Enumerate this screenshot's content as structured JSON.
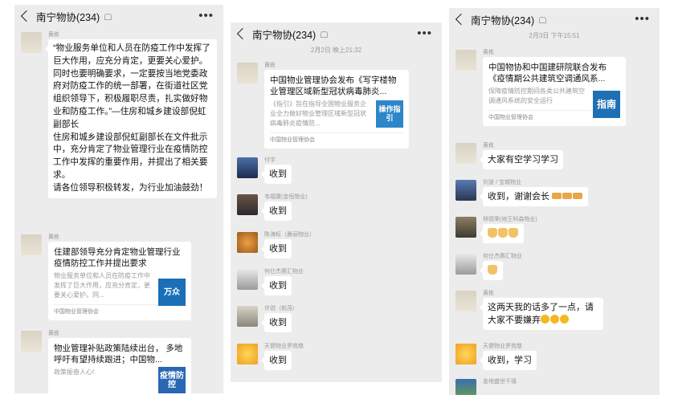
{
  "chat_title": "南宁物协(234)",
  "left": {
    "msg1": {
      "sender": "黄栋",
      "text": "“物业服务单位和人员在防疫工作中发挥了巨大作用，应充分肯定，更要关心爱护。同时也要明确要求，一定要按当地党委政府对防疫工作的统一部署，在街道社区党组织领导下，积极履职尽责，扎实做好物业和防疫工作。”—住房和城乡建设部倪虹副部长\n住房和城乡建设部倪虹副部长在文件批示中，充分肯定了物业管理行业在疫情防控工作中发挥的重要作用，并提出了相关要求。\n请各位领导积极转发，为行业加油鼓劲！"
    },
    "msg2": {
      "sender": "黄栋",
      "title": "住建部领导充分肯定物业管理行业疫情防控工作并提出要求",
      "desc": "物业服务单位和人员在防疫工作中发挥了巨大作用，应充分肯定，更要关心爱护。同...",
      "thumb": "万众",
      "source": "中国物业管理协会"
    },
    "msg3": {
      "sender": "黄栋",
      "title": "物业管理补贴政策陆续出台， 多地呼吁有望持续跟进；中国物...",
      "desc": "政策振奋人心!",
      "thumb": "疫情防控"
    }
  },
  "middle": {
    "time": "2月2日 晚上21:32",
    "card": {
      "sender": "黄栋",
      "title": "中国物业管理协会发布《写字楼物业管理区域新型冠状病毒肺炎...",
      "desc": "《指引》旨在指导全国物业服务企业全力做好物业管理区域新型冠状病毒肺炎疫情防...",
      "thumb": "操作指引",
      "source": "中国物业管理协会"
    },
    "replies": [
      {
        "sender": "付宇",
        "text": "收到"
      },
      {
        "sender": "韦福康(金恒物业)",
        "text": "收到"
      },
      {
        "sender": "陈海标（晨丽物业）",
        "text": "收到"
      },
      {
        "sender": "何仕杰赛汇物业",
        "text": "收到"
      },
      {
        "sender": "许锐（和茂）",
        "text": "收到"
      },
      {
        "sender": "天健物业罗苑慈",
        "text": "收到"
      }
    ]
  },
  "right": {
    "time": "2月3日 下午15:51",
    "card": {
      "sender": "黄栋",
      "title": "中国物协和中国建研院联合发布《疫情期公共建筑空调通风系...",
      "desc": "保障疫情防控期间各类公共建筑空调通风系统的安全运行",
      "thumb": "指南",
      "source": "中国物业管理协会"
    },
    "msgs": [
      {
        "sender": "黄栋",
        "text": "大家有空学习学习"
      },
      {
        "sender": "刘波 / 宝城物业",
        "text": "收到，谢谢会长"
      },
      {
        "sender": "林德荣(地王科森物业)",
        "text": ""
      },
      {
        "sender": "何仕杰赛汇物业",
        "text": ""
      },
      {
        "sender": "黄栋",
        "text": "这两天我的话多了一点，请大家不要嫌弃"
      },
      {
        "sender": "天健物业罗苑慈",
        "text": "收到，学习"
      },
      {
        "sender": "金地盛世千禧",
        "text": ""
      }
    ]
  },
  "colors": {
    "bg": "#ececec",
    "accent": "#3f8ad9"
  }
}
